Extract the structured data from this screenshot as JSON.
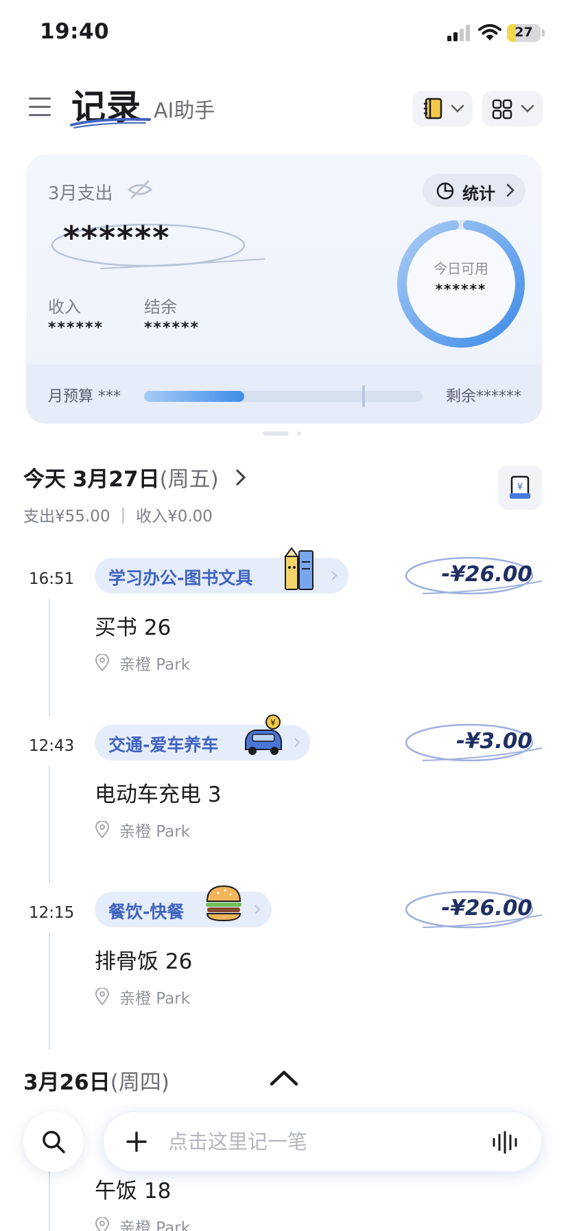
{
  "status_bar": {
    "time": "19:40",
    "battery": "27",
    "battery_level": 0.27
  },
  "header": {
    "title": "记录",
    "subtitle": "AI助手"
  },
  "summary": {
    "month_label": "3月支出",
    "stats_label": "统计",
    "total_masked": "******",
    "income_label": "收入",
    "income_value": "******",
    "balance_label": "结余",
    "balance_value": "******",
    "today_available_label": "今日可用",
    "today_available_value": "******",
    "budget_label": "月预算 ***",
    "budget_progress": 0.36,
    "remaining_label": "剩余******"
  },
  "day": {
    "title_prefix": "今天",
    "date": "3月27日",
    "weekday": "(周五)",
    "summary": "支出¥55.00 ｜ 收入¥0.00"
  },
  "entries": [
    {
      "time": "16:51",
      "category": "学习办公-图书文具",
      "amount": "-¥26.00",
      "note": "买书 26",
      "location": "亲橙 Park"
    },
    {
      "time": "12:43",
      "category": "交通-爱车养车",
      "amount": "-¥3.00",
      "note": "电动车充电 3",
      "location": "亲橙 Park"
    },
    {
      "time": "12:15",
      "category": "餐饮-快餐",
      "amount": "-¥26.00",
      "note": "排骨饭 26",
      "location": "亲橙 Park"
    }
  ],
  "day2": {
    "date": "3月26日",
    "weekday": "(周四)"
  },
  "entry_partial": {
    "note": "午饭 18",
    "location": "亲橙 Park"
  },
  "input_bar": {
    "placeholder": "点击这里记一笔"
  },
  "colors": {
    "accent": "#3f63c0",
    "ring": "#5fa2ee",
    "chip_bg": "#e6edfa"
  }
}
